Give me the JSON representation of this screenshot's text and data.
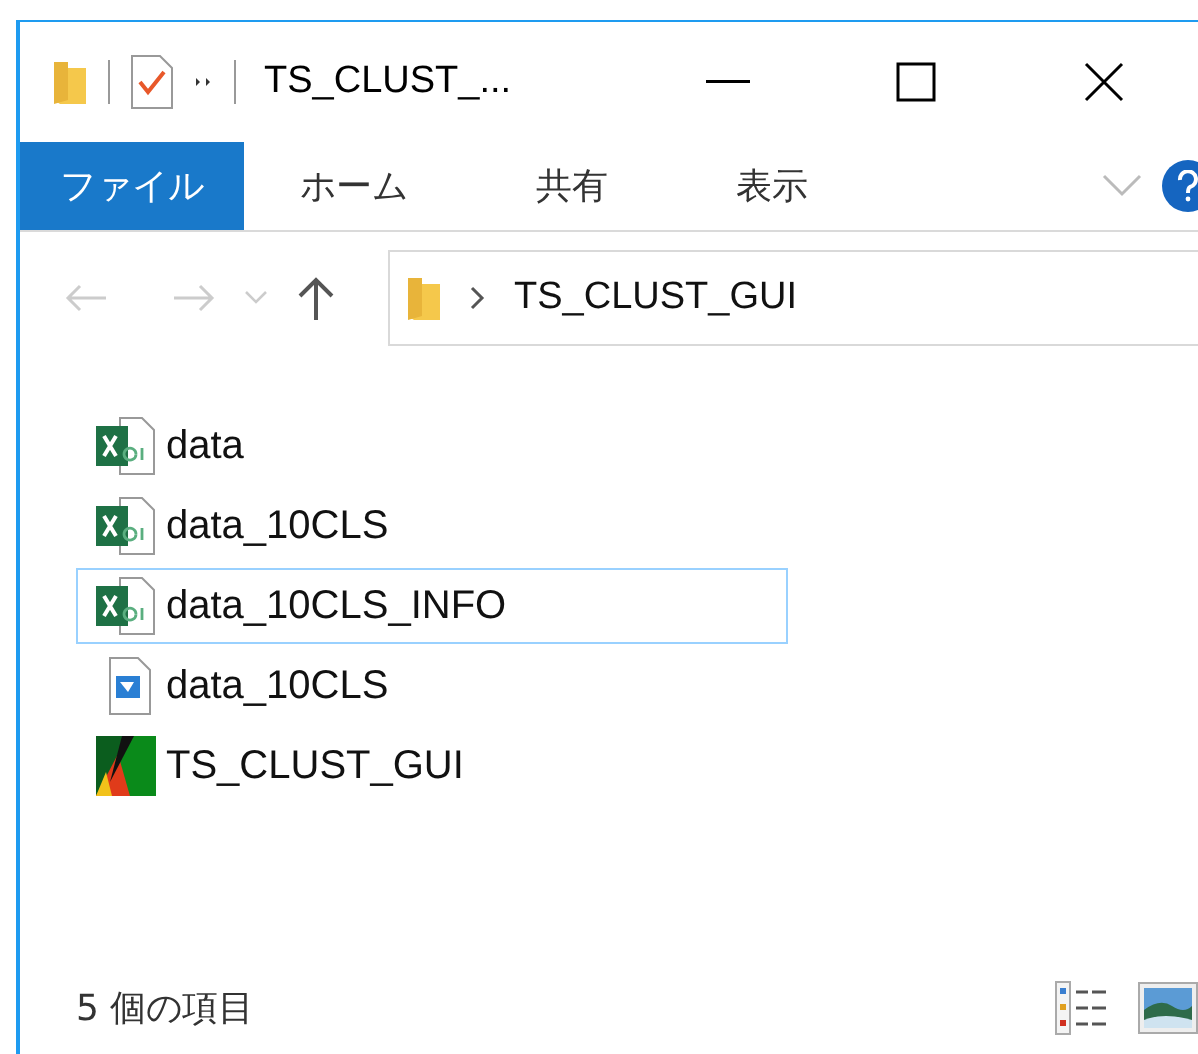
{
  "window": {
    "title": "TS_CLUST_..."
  },
  "ribbon_tabs": [
    {
      "label": "ファイル",
      "kind": "file"
    },
    {
      "label": "ホーム",
      "kind": "tab"
    },
    {
      "label": "共有",
      "kind": "tab"
    },
    {
      "label": "表示",
      "kind": "tab"
    }
  ],
  "address_bar": {
    "path": [
      "TS_CLUST_GUI"
    ]
  },
  "files": [
    {
      "name": "data",
      "kind": "excel",
      "focused": false
    },
    {
      "name": "data_10CLS",
      "kind": "excel",
      "focused": false
    },
    {
      "name": "data_10CLS_INFO",
      "kind": "excel",
      "focused": true
    },
    {
      "name": "data_10CLS",
      "kind": "image",
      "focused": false
    },
    {
      "name": "TS_CLUST_GUI",
      "kind": "app",
      "focused": false
    }
  ],
  "status_bar": {
    "item_count": "5 個の項目"
  }
}
